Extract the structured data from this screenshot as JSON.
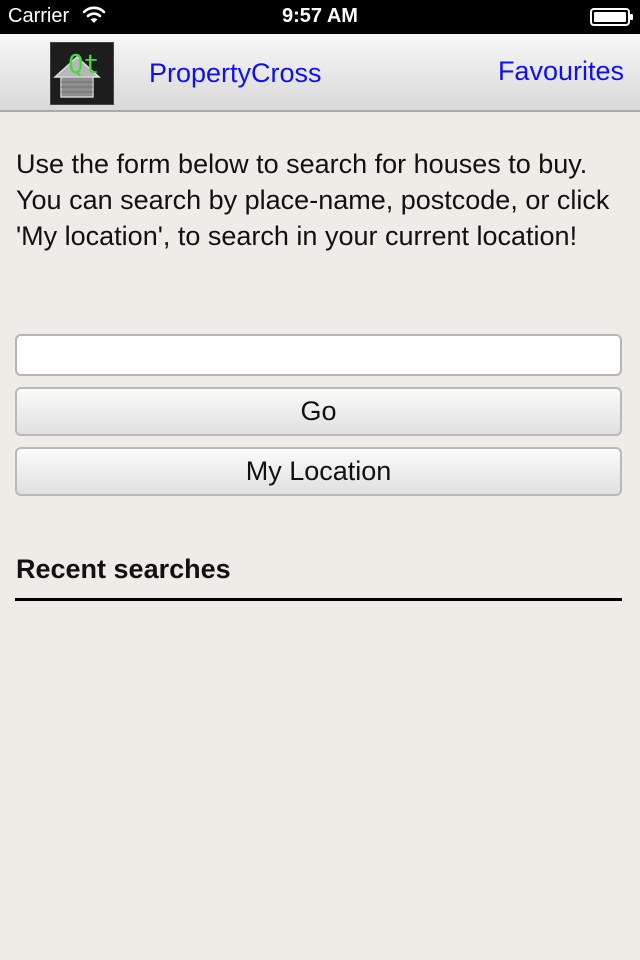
{
  "status_bar": {
    "carrier": "Carrier",
    "time": "9:57 AM"
  },
  "nav": {
    "title": "PropertyCross",
    "favourites": "Favourites",
    "logo_text": "Qt",
    "link_color": "#1010ee"
  },
  "intro": "Use the form below to search for houses to buy. You can search by place-name, postcode, or click 'My location', to search in your current location!",
  "search": {
    "value": "",
    "placeholder": ""
  },
  "buttons": {
    "go": "Go",
    "my_location": "My Location"
  },
  "recent": {
    "heading": "Recent searches",
    "items": []
  },
  "icons": {
    "wifi": "wifi-icon",
    "battery": "battery-icon",
    "logo": "house-logo-icon"
  }
}
